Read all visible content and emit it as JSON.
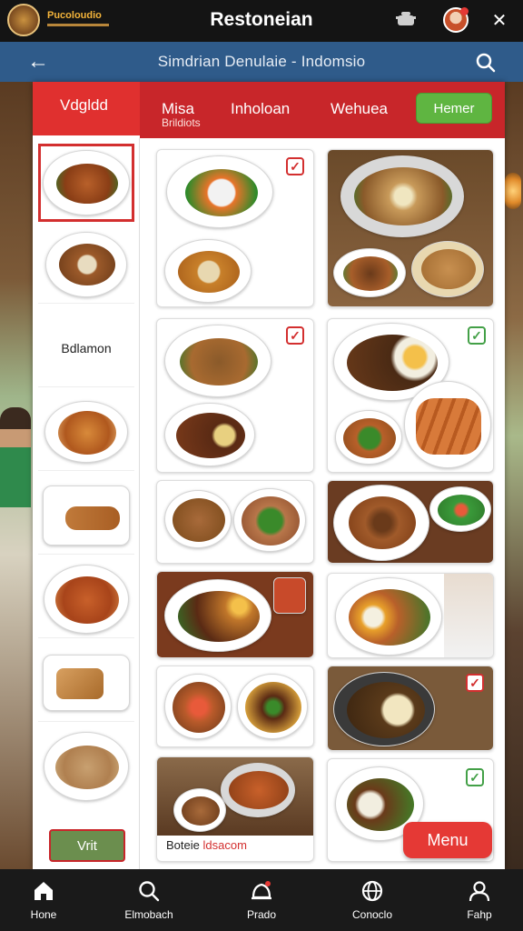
{
  "topbar": {
    "logo_text": "Pucoloudio",
    "title": "Restoneian",
    "icons": [
      "pot-icon",
      "avatar",
      "close-icon"
    ]
  },
  "subheader": {
    "title": "Simdrian Denulaie - Indomsio"
  },
  "tabs": {
    "active": "Vdgldd",
    "items": [
      {
        "label": "Misa",
        "sub": "Brildiots"
      },
      {
        "label": "Inholoan",
        "sub": ""
      },
      {
        "label": "Wehuea",
        "sub": ""
      }
    ],
    "button": "Hemer"
  },
  "sidebar": {
    "text_item": "Bdlamon",
    "button": "Vrit"
  },
  "grid": {
    "caption_prefix": "Boteie",
    "caption_highlight": "ldsacom",
    "menu_button": "Menu"
  },
  "bottom_nav": [
    {
      "label": "Hone",
      "icon": "home-icon"
    },
    {
      "label": "Elmobach",
      "icon": "search-icon"
    },
    {
      "label": "Prado",
      "icon": "dish-icon"
    },
    {
      "label": "Conoclo",
      "icon": "globe-icon"
    },
    {
      "label": "Fahp",
      "icon": "user-icon"
    }
  ],
  "colors": {
    "header": "#141414",
    "subheader": "#2f5b8a",
    "tab_red": "#c8262a",
    "accent_green": "#5fb541"
  }
}
